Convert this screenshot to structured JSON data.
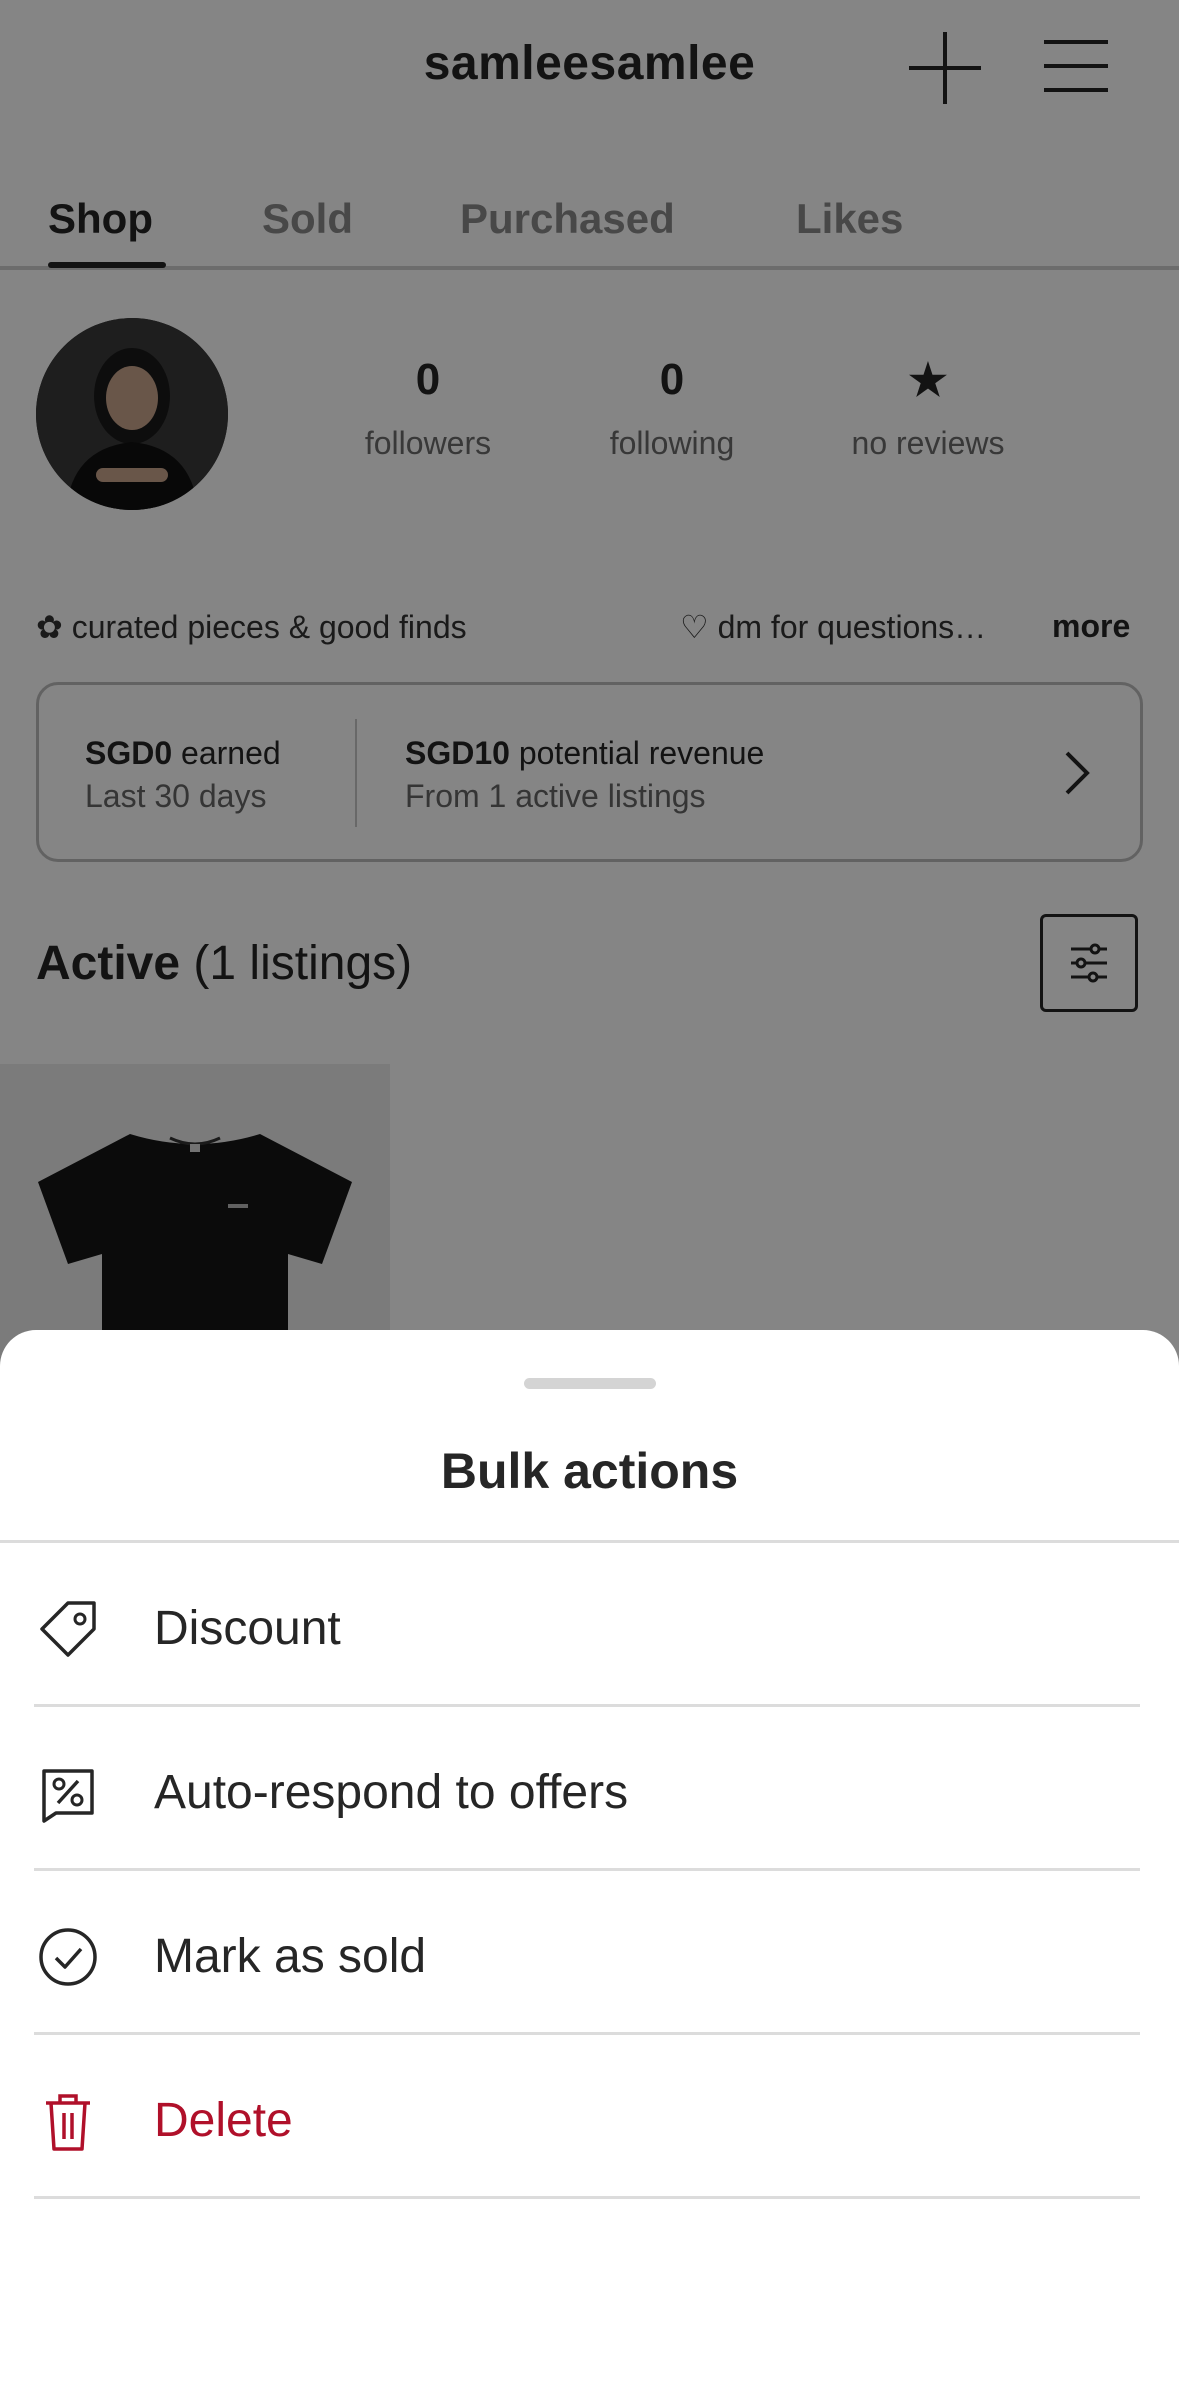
{
  "header": {
    "username": "samleesamlee",
    "add_icon": "plus-icon",
    "menu_icon": "hamburger-menu-icon"
  },
  "tabs": [
    {
      "label": "Shop",
      "active": true
    },
    {
      "label": "Sold",
      "active": false
    },
    {
      "label": "Purchased",
      "active": false
    },
    {
      "label": "Likes",
      "active": false
    }
  ],
  "profile": {
    "stats": [
      {
        "value": "0",
        "label": "followers"
      },
      {
        "value": "0",
        "label": "following"
      },
      {
        "value": "★",
        "label": "no reviews"
      }
    ],
    "bio_left": "✿ curated pieces & good finds",
    "bio_right": "♡ dm for questions…",
    "bio_more": "more"
  },
  "earnings": {
    "earned_amount": "SGD0",
    "earned_suffix": " earned",
    "earned_period": "Last 30 days",
    "revenue_amount": "SGD10",
    "revenue_suffix": " potential revenue",
    "revenue_source": "From 1 active listings"
  },
  "listings": {
    "title": "Active",
    "count": " (1 listings)",
    "filter_icon": "sliders-icon"
  },
  "bulk_actions": {
    "title": "Bulk actions",
    "items": [
      {
        "label": "Discount",
        "icon": "tag-icon"
      },
      {
        "label": "Auto-respond to offers",
        "icon": "percent-badge-icon"
      },
      {
        "label": "Mark as sold",
        "icon": "check-circle-icon"
      },
      {
        "label": "Delete",
        "icon": "trash-icon",
        "danger": true
      }
    ]
  },
  "colors": {
    "text": "#262626",
    "danger": "#b0102a",
    "overlay": "rgba(0,0,0,0.48)"
  }
}
